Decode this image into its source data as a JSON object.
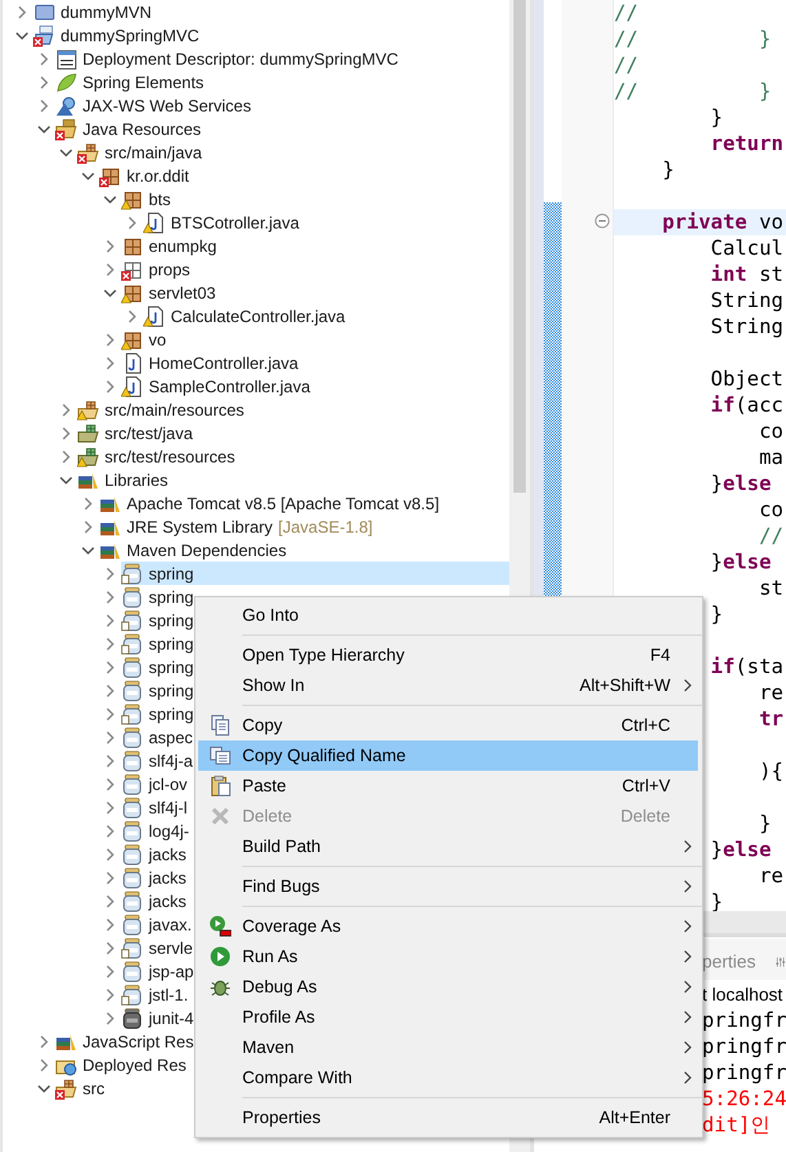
{
  "explorer": {
    "tree": [
      {
        "label": "dummyMVN",
        "kind": "mvn-project",
        "expanded": false,
        "selected": false
      },
      {
        "label": "dummySpringMVC",
        "kind": "project-error",
        "expanded": true,
        "selected": false,
        "children": [
          {
            "label": "Deployment Descriptor: dummySpringMVC",
            "kind": "descriptor",
            "expanded": false,
            "selected": false
          },
          {
            "label": "Spring Elements",
            "kind": "spring",
            "expanded": false,
            "selected": false
          },
          {
            "label": "JAX-WS Web Services",
            "kind": "webservice",
            "expanded": false,
            "selected": false
          },
          {
            "label": "Java Resources",
            "kind": "resources-error",
            "expanded": true,
            "selected": false,
            "children": [
              {
                "label": "src/main/java",
                "kind": "srcfolder-error",
                "expanded": true,
                "selected": false,
                "children": [
                  {
                    "label": "kr.or.ddit",
                    "kind": "package-error",
                    "expanded": true,
                    "selected": false,
                    "children": [
                      {
                        "label": "bts",
                        "kind": "package-warning",
                        "expanded": true,
                        "selected": false,
                        "children": [
                          {
                            "label": "BTSCotroller.java",
                            "kind": "javafile-warning",
                            "expanded": false,
                            "selected": false
                          }
                        ]
                      },
                      {
                        "label": "enumpkg",
                        "kind": "package",
                        "expanded": false,
                        "selected": false
                      },
                      {
                        "label": "props",
                        "kind": "emptypackage-error",
                        "expanded": false,
                        "selected": false
                      },
                      {
                        "label": "servlet03",
                        "kind": "package-warning",
                        "expanded": true,
                        "selected": false,
                        "children": [
                          {
                            "label": "CalculateController.java",
                            "kind": "javafile-warning",
                            "expanded": false,
                            "selected": false
                          }
                        ]
                      },
                      {
                        "label": "vo",
                        "kind": "package-warning",
                        "expanded": false,
                        "selected": false
                      },
                      {
                        "label": "HomeController.java",
                        "kind": "javafile",
                        "expanded": false,
                        "selected": false
                      },
                      {
                        "label": "SampleController.java",
                        "kind": "javafile-warning",
                        "expanded": false,
                        "selected": false
                      }
                    ]
                  }
                ]
              },
              {
                "label": "src/main/resources",
                "kind": "srcfolder-warning",
                "expanded": false,
                "selected": false
              },
              {
                "label": "src/test/java",
                "kind": "testfolder",
                "expanded": false,
                "selected": false
              },
              {
                "label": "src/test/resources",
                "kind": "testfolder-warning",
                "expanded": false,
                "selected": false
              },
              {
                "label": "Libraries",
                "kind": "library",
                "expanded": true,
                "selected": false,
                "children": [
                  {
                    "label": "Apache Tomcat v8.5 [Apache Tomcat v8.5]",
                    "kind": "library",
                    "expanded": false,
                    "selected": false
                  },
                  {
                    "label": "JRE System Library",
                    "decoration": "[JavaSE-1.8]",
                    "kind": "library",
                    "expanded": false,
                    "selected": false
                  },
                  {
                    "label": "Maven Dependencies",
                    "kind": "library",
                    "expanded": true,
                    "selected": false,
                    "children": [
                      {
                        "label": "spring",
                        "kind": "sourcejar",
                        "expanded": false,
                        "selected": true
                      },
                      {
                        "label": "spring",
                        "kind": "jar",
                        "expanded": false,
                        "selected": false
                      },
                      {
                        "label": "spring",
                        "kind": "sourcejar",
                        "expanded": false,
                        "selected": false
                      },
                      {
                        "label": "spring",
                        "kind": "sourcejar",
                        "expanded": false,
                        "selected": false
                      },
                      {
                        "label": "spring",
                        "kind": "jar",
                        "expanded": false,
                        "selected": false
                      },
                      {
                        "label": "spring",
                        "kind": "jar",
                        "expanded": false,
                        "selected": false
                      },
                      {
                        "label": "spring",
                        "kind": "sourcejar",
                        "expanded": false,
                        "selected": false
                      },
                      {
                        "label": "aspec",
                        "kind": "jar",
                        "expanded": false,
                        "selected": false
                      },
                      {
                        "label": "slf4j-a",
                        "kind": "jar",
                        "expanded": false,
                        "selected": false
                      },
                      {
                        "label": "jcl-ov",
                        "kind": "jar",
                        "expanded": false,
                        "selected": false
                      },
                      {
                        "label": "slf4j-l",
                        "kind": "jar",
                        "expanded": false,
                        "selected": false
                      },
                      {
                        "label": "log4j-",
                        "kind": "jar",
                        "expanded": false,
                        "selected": false
                      },
                      {
                        "label": "jacks",
                        "kind": "jar",
                        "expanded": false,
                        "selected": false
                      },
                      {
                        "label": "jacks",
                        "kind": "jar",
                        "expanded": false,
                        "selected": false
                      },
                      {
                        "label": "jacks",
                        "kind": "jar",
                        "expanded": false,
                        "selected": false
                      },
                      {
                        "label": "javax.",
                        "kind": "jar",
                        "expanded": false,
                        "selected": false
                      },
                      {
                        "label": "servle",
                        "kind": "sourcejar",
                        "expanded": false,
                        "selected": false
                      },
                      {
                        "label": "jsp-ap",
                        "kind": "jar",
                        "expanded": false,
                        "selected": false
                      },
                      {
                        "label": "jstl-1.",
                        "kind": "sourcejar",
                        "expanded": false,
                        "selected": false
                      },
                      {
                        "label": "junit-4",
                        "kind": "darkjar",
                        "expanded": false,
                        "selected": false
                      }
                    ]
                  }
                ]
              }
            ]
          },
          {
            "label": "JavaScript Res",
            "kind": "library",
            "expanded": false,
            "selected": false
          },
          {
            "label": "Deployed Res",
            "kind": "deployed",
            "expanded": false,
            "selected": false
          },
          {
            "label": "src",
            "kind": "srcfolder-error",
            "expanded": true,
            "selected": false
          }
        ]
      }
    ]
  },
  "editor": {
    "lines": [
      {
        "kind": "code",
        "current": false,
        "segments": [
          {
            "kind": "comment",
            "text": "//"
          }
        ]
      },
      {
        "kind": "code",
        "current": false,
        "segments": [
          {
            "kind": "comment",
            "text": "//          }"
          }
        ]
      },
      {
        "kind": "code",
        "current": false,
        "segments": [
          {
            "kind": "comment",
            "text": "//"
          }
        ]
      },
      {
        "kind": "code",
        "current": false,
        "segments": [
          {
            "kind": "comment",
            "text": "//          }"
          }
        ]
      },
      {
        "kind": "code",
        "current": false,
        "segments": [
          {
            "kind": "plain",
            "text": "        }"
          }
        ]
      },
      {
        "kind": "code",
        "current": false,
        "segments": [
          {
            "kind": "keyword",
            "text": "        return"
          }
        ]
      },
      {
        "kind": "code",
        "current": false,
        "segments": [
          {
            "kind": "plain",
            "text": "    }"
          }
        ]
      },
      {
        "kind": "blank"
      },
      {
        "kind": "code",
        "current": true,
        "folding": true,
        "segments": [
          {
            "kind": "keyword",
            "text": "    private"
          },
          {
            "kind": "plain",
            "text": " vo"
          }
        ]
      },
      {
        "kind": "code",
        "current": false,
        "segments": [
          {
            "kind": "plain",
            "text": "        Calcul"
          }
        ]
      },
      {
        "kind": "code",
        "current": false,
        "segments": [
          {
            "kind": "keyword",
            "text": "        int"
          },
          {
            "kind": "plain",
            "text": " st"
          }
        ]
      },
      {
        "kind": "code",
        "current": false,
        "segments": [
          {
            "kind": "plain",
            "text": "        String"
          }
        ]
      },
      {
        "kind": "code",
        "current": false,
        "segments": [
          {
            "kind": "plain",
            "text": "        String"
          }
        ]
      },
      {
        "kind": "blank"
      },
      {
        "kind": "code",
        "current": false,
        "segments": [
          {
            "kind": "plain",
            "text": "        Object"
          }
        ]
      },
      {
        "kind": "code",
        "current": false,
        "segments": [
          {
            "kind": "keyword",
            "text": "        if"
          },
          {
            "kind": "plain",
            "text": "(acc"
          }
        ]
      },
      {
        "kind": "code",
        "current": false,
        "segments": [
          {
            "kind": "plain",
            "text": "            co"
          }
        ]
      },
      {
        "kind": "code",
        "current": false,
        "segments": [
          {
            "kind": "plain",
            "text": "            ma"
          }
        ]
      },
      {
        "kind": "code",
        "current": false,
        "segments": [
          {
            "kind": "plain",
            "text": "        }"
          },
          {
            "kind": "keyword",
            "text": "else"
          }
        ]
      },
      {
        "kind": "code",
        "current": false,
        "segments": [
          {
            "kind": "plain",
            "text": "            co"
          }
        ]
      },
      {
        "kind": "code",
        "current": false,
        "segments": [
          {
            "kind": "comment",
            "text": "            //"
          }
        ]
      },
      {
        "kind": "code",
        "current": false,
        "segments": [
          {
            "kind": "plain",
            "text": "        }"
          },
          {
            "kind": "keyword",
            "text": "else"
          }
        ]
      },
      {
        "kind": "code",
        "current": false,
        "segments": [
          {
            "kind": "plain",
            "text": "            st"
          }
        ]
      },
      {
        "kind": "code",
        "current": false,
        "segments": [
          {
            "kind": "plain",
            "text": "        }"
          }
        ]
      },
      {
        "kind": "blank"
      },
      {
        "kind": "code",
        "current": false,
        "segments": [
          {
            "kind": "keyword",
            "text": "        if"
          },
          {
            "kind": "plain",
            "text": "(sta"
          }
        ]
      },
      {
        "kind": "code",
        "current": false,
        "segments": [
          {
            "kind": "plain",
            "text": "            re"
          }
        ]
      },
      {
        "kind": "code",
        "current": false,
        "segments": [
          {
            "kind": "keyword",
            "text": "            tr"
          }
        ]
      },
      {
        "kind": "blank"
      },
      {
        "kind": "code",
        "current": false,
        "segments": [
          {
            "kind": "plain",
            "text": "            ){"
          }
        ]
      },
      {
        "kind": "blank"
      },
      {
        "kind": "code",
        "current": false,
        "segments": [
          {
            "kind": "plain",
            "text": "            }"
          }
        ]
      },
      {
        "kind": "code",
        "current": false,
        "segments": [
          {
            "kind": "plain",
            "text": "        }"
          },
          {
            "kind": "keyword",
            "text": "else"
          }
        ]
      },
      {
        "kind": "code",
        "current": false,
        "segments": [
          {
            "kind": "plain",
            "text": "            re"
          }
        ]
      },
      {
        "kind": "code",
        "current": false,
        "segments": [
          {
            "kind": "plain",
            "text": "        }"
          }
        ]
      }
    ]
  },
  "console": {
    "tab": "perties",
    "server": "t localhost",
    "lines": [
      {
        "kind": "info",
        "text": "pringfr"
      },
      {
        "kind": "info",
        "text": "pringfr"
      },
      {
        "kind": "info",
        "text": "pringfr"
      },
      {
        "kind": "error",
        "text": "5:26:24"
      },
      {
        "kind": "error",
        "text": "dit]인"
      }
    ]
  },
  "context_menu": {
    "items": [
      {
        "kind": "item",
        "label": "Go Into",
        "submenu": false,
        "disabled": false,
        "selected": false
      },
      {
        "kind": "separator"
      },
      {
        "kind": "item",
        "label": "Open Type Hierarchy",
        "shortcut": "F4",
        "submenu": false,
        "disabled": false,
        "selected": false
      },
      {
        "kind": "item",
        "label": "Show In",
        "shortcut": "Alt+Shift+W",
        "submenu": true,
        "disabled": false,
        "selected": false
      },
      {
        "kind": "separator"
      },
      {
        "kind": "copy",
        "label": "Copy",
        "shortcut": "Ctrl+C",
        "submenu": false,
        "disabled": false,
        "selected": false
      },
      {
        "kind": "copy-name",
        "label": "Copy Qualified Name",
        "submenu": false,
        "disabled": false,
        "selected": true
      },
      {
        "kind": "paste",
        "label": "Paste",
        "shortcut": "Ctrl+V",
        "submenu": false,
        "disabled": false,
        "selected": false
      },
      {
        "kind": "delete",
        "label": "Delete",
        "shortcut": "Delete",
        "submenu": false,
        "disabled": true,
        "selected": false
      },
      {
        "kind": "item",
        "label": "Build Path",
        "submenu": true,
        "disabled": false,
        "selected": false
      },
      {
        "kind": "separator"
      },
      {
        "kind": "item",
        "label": "Find Bugs",
        "submenu": true,
        "disabled": false,
        "selected": false
      },
      {
        "kind": "separator"
      },
      {
        "kind": "coverage",
        "label": "Coverage As",
        "submenu": true,
        "disabled": false,
        "selected": false
      },
      {
        "kind": "run",
        "label": "Run As",
        "submenu": true,
        "disabled": false,
        "selected": false
      },
      {
        "kind": "debug",
        "label": "Debug As",
        "submenu": true,
        "disabled": false,
        "selected": false
      },
      {
        "kind": "item",
        "label": "Profile As",
        "submenu": true,
        "disabled": false,
        "selected": false
      },
      {
        "kind": "item",
        "label": "Maven",
        "submenu": true,
        "disabled": false,
        "selected": false
      },
      {
        "kind": "item",
        "label": "Compare With",
        "submenu": true,
        "disabled": false,
        "selected": false
      },
      {
        "kind": "separator"
      },
      {
        "kind": "item",
        "label": "Properties",
        "shortcut": "Alt+Enter",
        "submenu": false,
        "disabled": false,
        "selected": false
      }
    ]
  }
}
